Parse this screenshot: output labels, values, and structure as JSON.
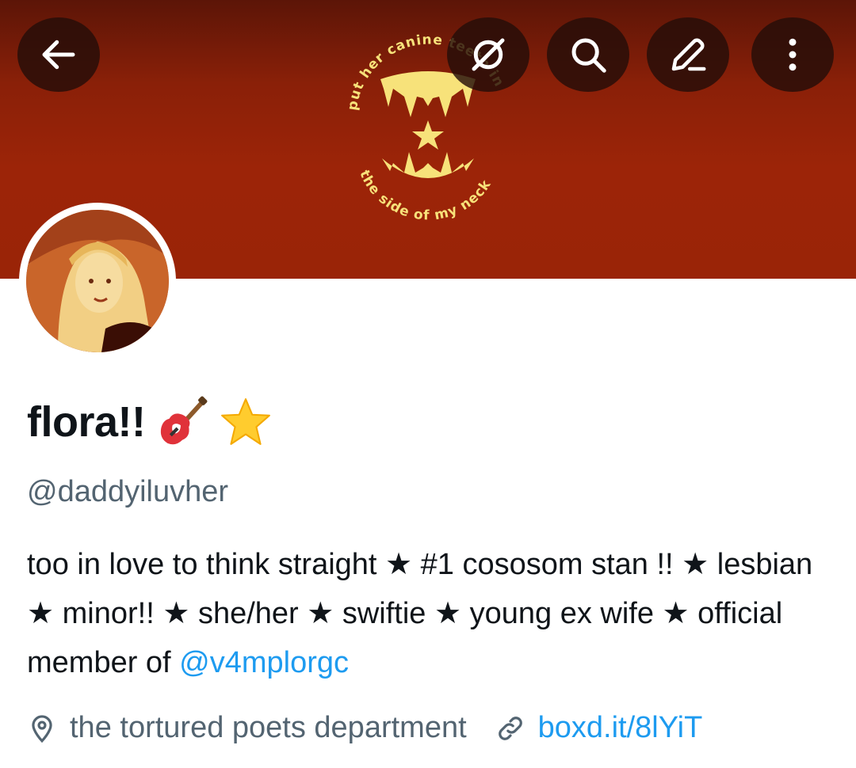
{
  "banner": {
    "top_text": "put her canine teeth in",
    "bottom_text": "the side of my neck",
    "colors": {
      "background": "#9c2408",
      "art": "#f7e27a"
    }
  },
  "toolbar": {
    "back_icon": "arrow-left-icon",
    "grok_icon": "grok-icon",
    "search_icon": "search-icon",
    "edit_icon": "pencil-icon",
    "more_icon": "more-vertical-icon"
  },
  "profile": {
    "name": "flora!!",
    "name_emojis": [
      "guitar-emoji",
      "star-emoji"
    ],
    "handle": "@daddyiluvher",
    "bio_text": "too in love to think straight ★ #1 cososom stan !! ★ lesbian ★ minor!! ★ she/her ★ swiftie ★ young ex wife ★ official member of ",
    "bio_mention": "@v4mplorgc",
    "location": "the tortured poets department",
    "website": "boxd.it/8lYiT",
    "location_icon": "location-pin-icon",
    "link_icon": "link-icon"
  },
  "colors": {
    "accent": "#1d9bf0",
    "secondary_text": "#536471",
    "primary_text": "#0f1419"
  }
}
